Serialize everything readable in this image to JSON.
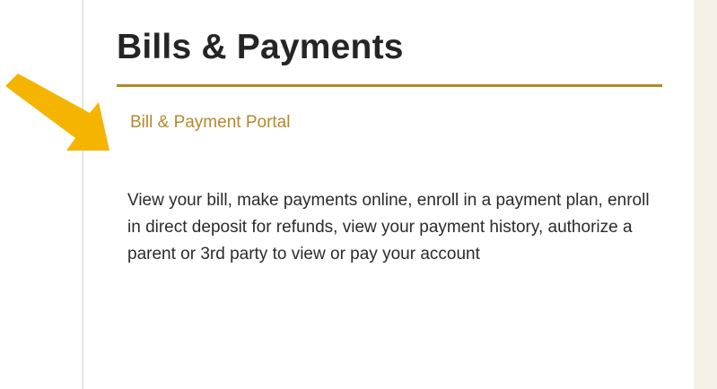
{
  "section": {
    "title": "Bills & Payments",
    "link_label": "Bill & Payment Portal",
    "description": "View your bill, make payments online, enroll in a payment plan, enroll in direct deposit for refunds, view your payment history, authorize a parent or 3rd party to view or pay your account"
  },
  "annotation": {
    "icon": "arrow-right-down-icon",
    "color": "#f4b400"
  },
  "colors": {
    "title_text": "#252525",
    "underline": "#b08a1e",
    "link": "#b5892a",
    "body_text": "#2b2b2b",
    "side_panel": "#f6f1e7"
  }
}
